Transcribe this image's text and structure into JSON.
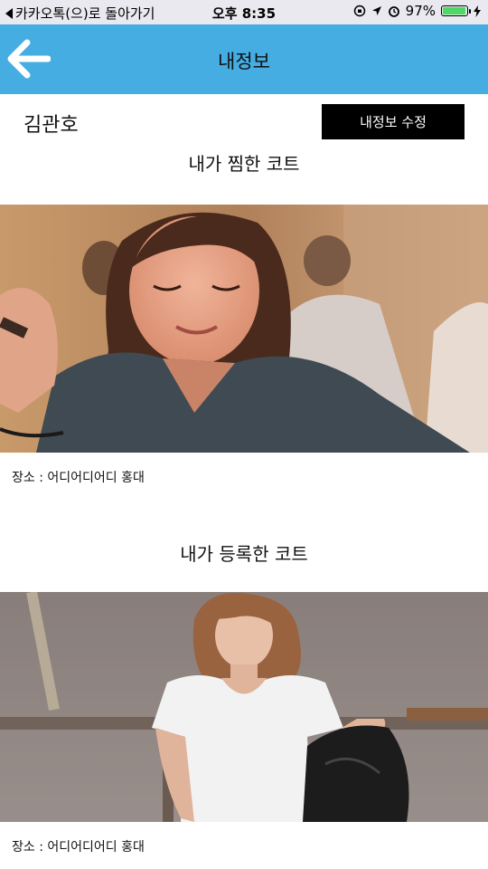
{
  "status_bar": {
    "back_app": "카카오톡(으)로 돌아가기",
    "time": "오후 8:35",
    "battery": "97%",
    "battery_level": 0.97
  },
  "header": {
    "title": "내정보",
    "back_icon": "arrow-left-icon",
    "bg_color": "#45ade2"
  },
  "profile": {
    "name": "김관호",
    "edit_label": "내정보 수정"
  },
  "liked": {
    "title": "내가 찜한 코트",
    "location": "장소 : 어디어디어디 홍대"
  },
  "registered": {
    "title": "내가 등록한 코트",
    "location": "장소 : 어디어디어디 홍대"
  }
}
